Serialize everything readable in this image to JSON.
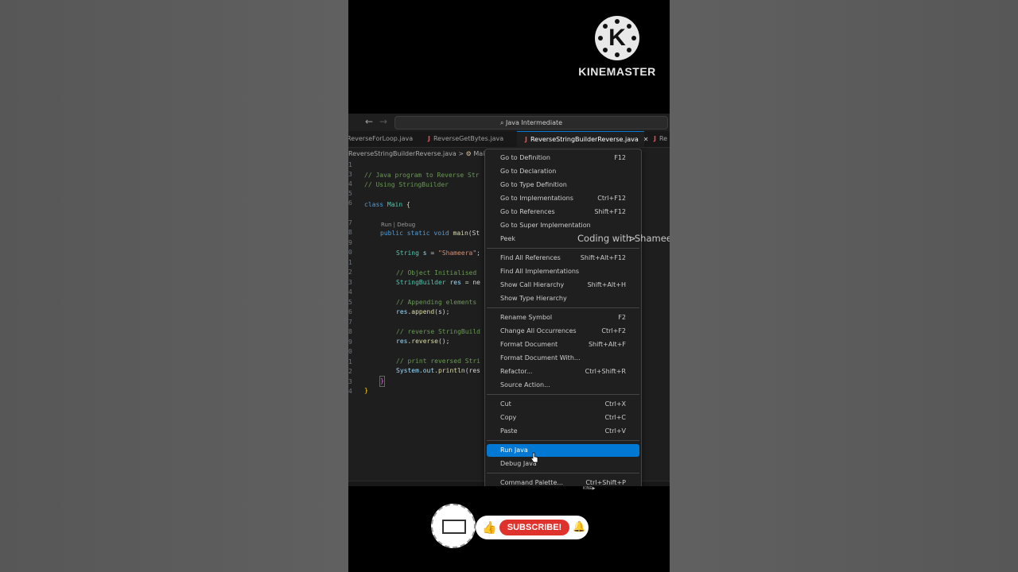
{
  "watermark": {
    "brand": "KINEMASTER",
    "logo_letter": "K",
    "small": "KINE▶"
  },
  "titlebar": {
    "search": "Java Intermediate"
  },
  "tabs": [
    {
      "label": "ReverseForLoop.java"
    },
    {
      "label": "ReverseGetBytes.java"
    },
    {
      "label": "ReverseStringBuilderReverse.java",
      "active": true
    },
    {
      "label": "Re"
    }
  ],
  "breadcrumb": {
    "file": "ReverseStringBuilderReverse.java",
    "sep": ">",
    "symbol": "Main",
    "tail": ">"
  },
  "codelens": "Run | Debug",
  "code_lines": {
    "l1": "// Java program to Reverse Str",
    "l2": "// Using StringBuilder",
    "l3_kw": "class",
    "l3_cls": "Main",
    "l3_br": " {",
    "l5_kw": "public static void",
    "l5_fn": "main",
    "l5_rest": "(St",
    "l6_cls": "String",
    "l6_var": " s",
    "l6_eq": " = ",
    "l6_str": "\"Shameera\"",
    "l6_end": ";",
    "l7": "// Object Initialised",
    "l8_cls": "StringBuilder",
    "l8_var": " res",
    "l8_rest": " = ne",
    "l9": "// Appending elements",
    "l10_var": "res",
    "l10_fn": ".append",
    "l10_rest": "(s);",
    "l11": "// reverse StringBuild",
    "l12_var": "res",
    "l12_fn": ".reverse",
    "l12_rest": "();",
    "l13": "// print reversed Stri",
    "l14_var": "System.out",
    "l14_fn": ".println",
    "l14_rest": "(res",
    "l15": "}",
    "l16": "}"
  },
  "line_numbers": [
    "1",
    "3",
    "4",
    "5",
    "6",
    "",
    "7",
    "8",
    "9",
    "0",
    "1",
    "2",
    "3",
    "4",
    "5",
    "6",
    "7",
    "8",
    "9",
    "0",
    "1",
    "2",
    "3",
    "4"
  ],
  "overlay_text": "Coding with Shameera",
  "context_menu": {
    "items": [
      {
        "label": "Go to Definition",
        "shortcut": "F12"
      },
      {
        "label": "Go to Declaration",
        "shortcut": ""
      },
      {
        "label": "Go to Type Definition",
        "shortcut": ""
      },
      {
        "label": "Go to Implementations",
        "shortcut": "Ctrl+F12"
      },
      {
        "label": "Go to References",
        "shortcut": "Shift+F12"
      },
      {
        "label": "Go to Super Implementation",
        "shortcut": ""
      },
      {
        "label": "Peek",
        "shortcut": ">"
      },
      {
        "label": "Find All References",
        "shortcut": "Shift+Alt+F12"
      },
      {
        "label": "Find All Implementations",
        "shortcut": ""
      },
      {
        "label": "Show Call Hierarchy",
        "shortcut": "Shift+Alt+H"
      },
      {
        "label": "Show Type Hierarchy",
        "shortcut": ""
      },
      {
        "label": "Rename Symbol",
        "shortcut": "F2"
      },
      {
        "label": "Change All Occurrences",
        "shortcut": "Ctrl+F2"
      },
      {
        "label": "Format Document",
        "shortcut": "Shift+Alt+F"
      },
      {
        "label": "Format Document With...",
        "shortcut": ""
      },
      {
        "label": "Refactor...",
        "shortcut": "Ctrl+Shift+R"
      },
      {
        "label": "Source Action...",
        "shortcut": ""
      },
      {
        "label": "Cut",
        "shortcut": "Ctrl+X"
      },
      {
        "label": "Copy",
        "shortcut": "Ctrl+C"
      },
      {
        "label": "Paste",
        "shortcut": "Ctrl+V"
      },
      {
        "label": "Run Java",
        "shortcut": "",
        "selected": true
      },
      {
        "label": "Debug Java",
        "shortcut": ""
      },
      {
        "label": "Command Palette...",
        "shortcut": "Ctrl+Shift+P"
      }
    ]
  },
  "subscribe": {
    "label": "SUBSCRIBE!"
  },
  "colors": {
    "accent": "#0078d4",
    "subscribe": "#e0322d",
    "editor_bg": "#1e1e1e",
    "menu_bg": "#1f1f1f"
  }
}
